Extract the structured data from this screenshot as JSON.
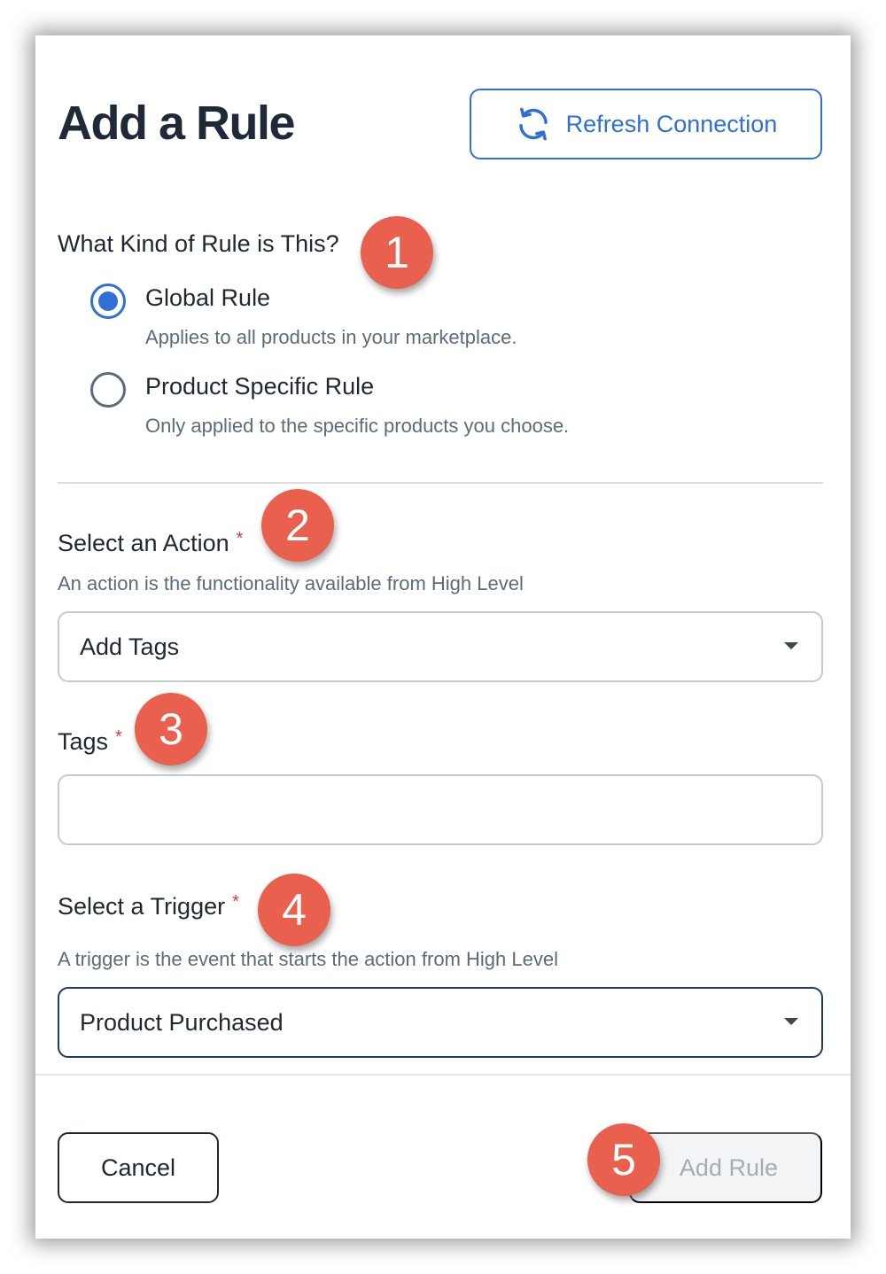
{
  "modal": {
    "title": "Add a Rule",
    "refresh_label": "Refresh Connection",
    "refresh_icon": "refresh-icon",
    "accent_color": "#2f6fd6"
  },
  "rule_kind": {
    "question": "What Kind of Rule is This?",
    "options": [
      {
        "label": "Global Rule",
        "description": "Applies to all products in your marketplace.",
        "selected": true
      },
      {
        "label": "Product Specific Rule",
        "description": "Only applied to the specific products you choose.",
        "selected": false
      }
    ]
  },
  "action": {
    "label": "Select an Action",
    "required_mark": "*",
    "help": "An action is the functionality available from High Level",
    "value": "Add Tags"
  },
  "tags": {
    "label": "Tags",
    "required_mark": "*",
    "value": ""
  },
  "trigger": {
    "label": "Select a Trigger",
    "required_mark": "*",
    "help": "A trigger is the event that starts the action from High Level",
    "value": "Product Purchased"
  },
  "footer": {
    "cancel_label": "Cancel",
    "submit_label": "Add Rule"
  },
  "annotations": {
    "badge_color": "#e9604e",
    "labels": [
      "1",
      "2",
      "3",
      "4",
      "5"
    ]
  }
}
